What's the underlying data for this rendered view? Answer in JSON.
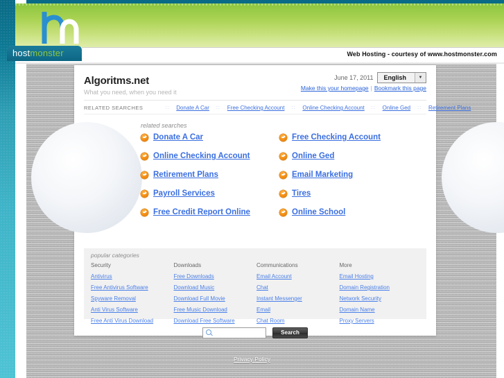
{
  "host_banner": {
    "logo_host": "host",
    "logo_monster": "monster",
    "courtesy_text": "Web Hosting - courtesy of www.hostmonster.com"
  },
  "site": {
    "title": "Algoritms.net",
    "tagline": "What you need, when you need it",
    "date": "June 17, 2011",
    "language": "English",
    "homepage_link": "Make this your homepage",
    "separator": "|",
    "bookmark_link": "Bookmark this page"
  },
  "related_bar": {
    "label": "RELATED SEARCHES",
    "dots": "::",
    "items": [
      "Donate A Car",
      "Free Checking Account",
      "Online Checking Account",
      "Online Ged",
      "Retirement Plans"
    ]
  },
  "related_block": {
    "heading": "related searches",
    "rows": [
      [
        "Donate A Car",
        "Free Checking Account"
      ],
      [
        "Online Checking Account",
        "Online Ged"
      ],
      [
        "Retirement Plans",
        "Email Marketing"
      ],
      [
        "Payroll Services",
        "Tires"
      ],
      [
        "Free Credit Report Online",
        "Online School"
      ]
    ]
  },
  "popular_categories": {
    "heading": "popular categories",
    "columns": [
      {
        "title": "Security",
        "items": [
          "Antivirus",
          "Free Antivirus Software",
          "Spyware Removal",
          "Anti Virus Software",
          "Free Anti Virus Download"
        ]
      },
      {
        "title": "Downloads",
        "items": [
          "Free Downloads",
          "Download Music",
          "Download Full Movie",
          "Free Music Download",
          "Download Free Software"
        ]
      },
      {
        "title": "Communications",
        "items": [
          "Email Account",
          "Chat",
          "Instant Messenger",
          "Email",
          "Chat Room"
        ]
      },
      {
        "title": "More",
        "items": [
          "Email Hosting",
          "Domain Registration",
          "Network Security",
          "Domain Name",
          "Proxy Servers"
        ]
      }
    ]
  },
  "search": {
    "value": "",
    "placeholder": "",
    "button_label": "Search"
  },
  "footer": {
    "privacy_policy": "Privacy Policy"
  },
  "colors": {
    "teal": "#0a6b86",
    "green": "#8cc63f",
    "link_blue": "#3b6fe0",
    "accent_orange": "#f28c12"
  }
}
